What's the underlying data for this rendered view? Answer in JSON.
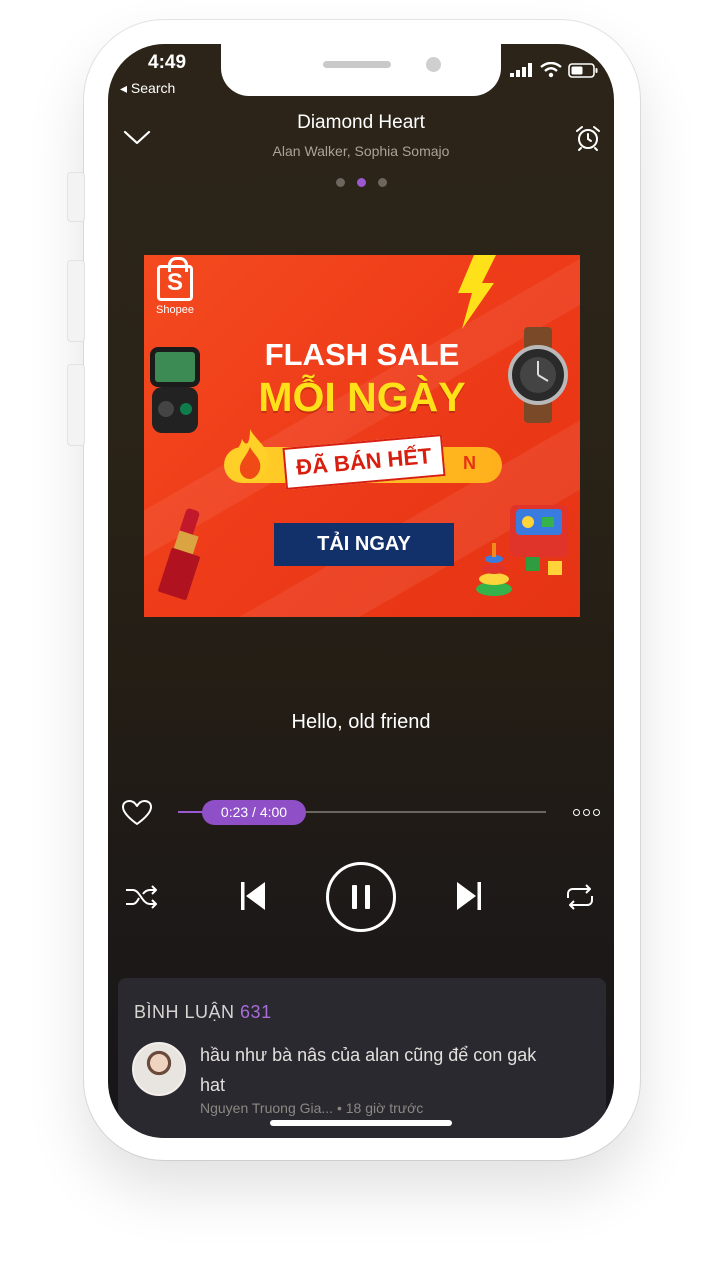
{
  "status_bar": {
    "time": "4:49",
    "back_label": "◂ Search"
  },
  "now_playing": {
    "title": "Diamond Heart",
    "artist": "Alan Walker, Sophia Somajo",
    "page_count": 3,
    "active_page": 2
  },
  "ad": {
    "brand": "Shopee",
    "logo_letter": "S",
    "headline_1": "FLASH SALE",
    "headline_2": "MỖI NGÀY",
    "stamp": "ĐÃ BÁN HẾT",
    "pill_tail": "N",
    "cta": "TẢI NGAY"
  },
  "lyric": "Hello, old friend",
  "player": {
    "elapsed": "0:23",
    "duration": "4:00",
    "time_display": "0:23 / 4:00",
    "progress_fraction": 0.096
  },
  "comments": {
    "title": "BÌNH LUẬN",
    "count": "631",
    "items": [
      {
        "text": "hầu như bà nâs của alan cũng để con gak hat",
        "author": "Nguyen Truong Gia...",
        "time": "• 18 giờ trước"
      }
    ]
  },
  "icons": {
    "collapse": "chevron-down-icon",
    "alarm": "alarm-clock-icon",
    "like": "heart-icon",
    "more": "more-icon",
    "shuffle": "shuffle-icon",
    "previous": "skip-previous-icon",
    "pause": "pause-icon",
    "next": "skip-next-icon",
    "repeat": "repeat-icon"
  },
  "colors": {
    "accent": "#9a59d0",
    "ad_background": "#ee3b19",
    "ad_cta": "#12306a",
    "ad_highlight": "#ffe11a"
  }
}
